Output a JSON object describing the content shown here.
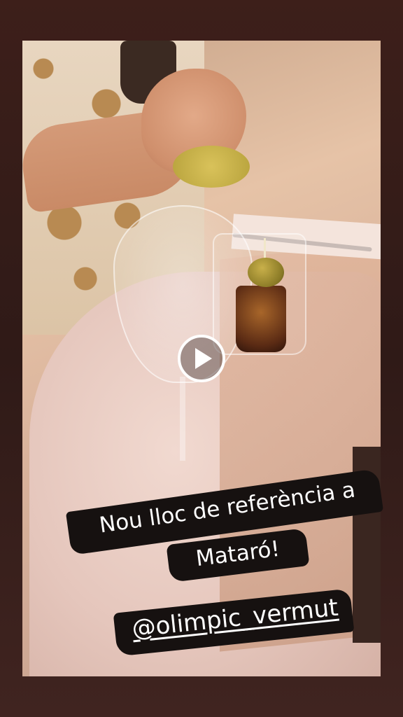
{
  "story": {
    "caption": {
      "line1": "Nou lloc de referència a",
      "line2": "Mataró!"
    },
    "mention": "@olimpic_vermut",
    "play_icon": "play-icon"
  },
  "colors": {
    "frame": "#3a1d18",
    "caption_text": "#ffffff",
    "caption_background": "#161110"
  }
}
